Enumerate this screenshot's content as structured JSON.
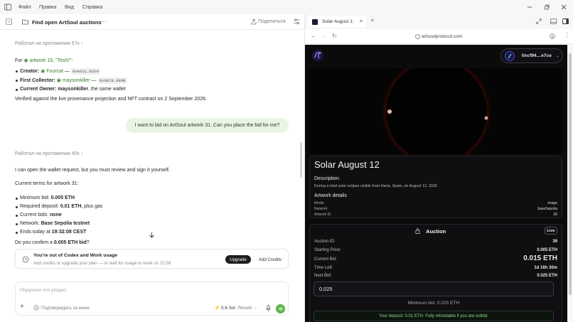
{
  "menubar": {
    "items": [
      "Файл",
      "Правка",
      "Вид",
      "Справка"
    ]
  },
  "chat": {
    "title": "Find open ArtSoul auctions",
    "share_label": "Поделиться",
    "worked1": "Работал на протяжении 57s",
    "for_prefix": "For",
    "artwork_ref": "artwork 19, \"TestV\"",
    "creator_label": "Creator:",
    "creator_name": "Fourcat",
    "creator_addr": "0xA61C…0329",
    "first_collector_label": "First Collector:",
    "first_collector_name": "maysonkiller",
    "first_collector_addr": "0x6EC8…989B",
    "owner_label": "Current Owner:",
    "owner_name": "maysonkiller",
    "owner_suffix": ", the same wallet",
    "verified_text": "Verified against the live provenance projection and NFT contract on 2 September 2026.",
    "user_message": "I want to bid on ArtSoul artwork 31. Can you place the bid for me?",
    "worked2": "Работал на протяжении 40s",
    "reply_intro": "I can open the wallet request, but you must review and sign it yourself.",
    "terms_title": "Current terms for artwork 31:",
    "terms": [
      {
        "label": "Minimum bid:",
        "value": "0.005 ETH",
        "suffix": ""
      },
      {
        "label": "Required deposit:",
        "value": "0.01 ETH",
        "suffix": ", plus gas"
      },
      {
        "label": "Current bids:",
        "value": "none",
        "suffix": ""
      },
      {
        "label": "Network:",
        "value": "Base Sepolia testnet",
        "suffix": ""
      },
      {
        "label": "Ends today at",
        "value": "19:32:08 CEST",
        "suffix": ""
      }
    ],
    "confirm_prefix": "Do you confirm a",
    "confirm_value": "0.005 ETH bid",
    "confirm_suffix": "?",
    "usage": {
      "title": "You're out of Codex and Work usage",
      "subtitle": "Add credits or upgrade your plan — or wait for usage to reset on 22:59",
      "upgrade_label": "Upgrade",
      "credits_label": "Add Credits"
    },
    "composer": {
      "placeholder": "Поручите что угодно",
      "approve_label": "Подтверждать за меня",
      "model_label": "5.6 Sol",
      "effort_label": "Лёгкий"
    }
  },
  "browser": {
    "tab_title": "Solar August 1:",
    "url": "artsoulprotocol.com",
    "wallet": "0xcf94…e7ce",
    "artwork": {
      "title": "Solar August 12",
      "description_label": "Description",
      "description": "During a total solar eclipse visible from Haria, Spain, on August 12, 2026",
      "details_label": "Artwork details",
      "details": [
        {
          "key": "Media",
          "value": "image"
        },
        {
          "key": "Network",
          "value": "baseSepolia"
        },
        {
          "key": "Artwork ID",
          "value": "30"
        }
      ]
    },
    "auction": {
      "title": "Auction",
      "status": "Live",
      "auction_id_label": "Auction ID:",
      "auction_id": "39",
      "starting_price_label": "Starting Price:",
      "starting_price": "0.005 ETH",
      "current_bid_label": "Current Bid:",
      "current_bid": "0.015 ETH",
      "time_left_label": "Time Left:",
      "time_left": "1d 16h 30m",
      "next_bid_label": "Next Bid:",
      "next_bid": "0.025 ETH",
      "bid_input": "0,025",
      "min_bid_text": "Minimum bid: 0.025 ETH",
      "deposit_note": "Your deposit: 0.01 ETH. Fully refundable if you are outbid."
    }
  }
}
